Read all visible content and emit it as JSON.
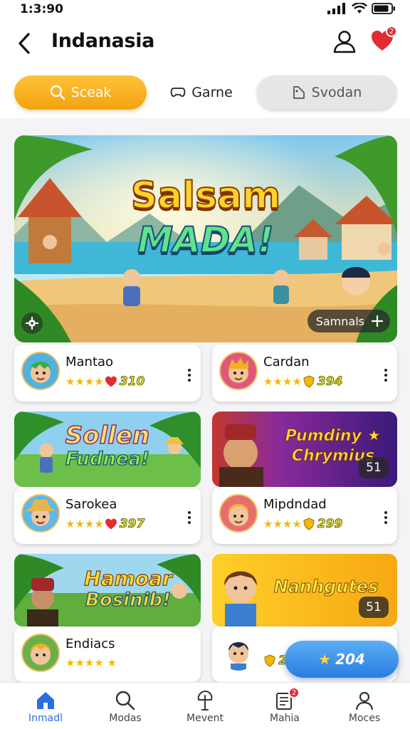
{
  "status": {
    "time": "1:3:90"
  },
  "header": {
    "title": "Indanasia",
    "notif_count": "2"
  },
  "tabs": [
    {
      "label": "Sceak",
      "icon": "search-icon"
    },
    {
      "label": "Garne",
      "icon": "game-icon"
    },
    {
      "label": "Svodan",
      "icon": "tag-icon"
    }
  ],
  "hero": {
    "title_line1": "Salsam",
    "title_line2": "MADA!",
    "chip_label": "Samnals",
    "chip_icon": "plus-icon"
  },
  "cards": [
    {
      "name": "Mantao",
      "score": "310",
      "rating_icon": "heart-icon",
      "stars": 4
    },
    {
      "name": "Cardan",
      "score": "394",
      "rating_icon": "shield-icon",
      "stars": 4
    },
    {
      "name": "Sarokea",
      "score": "397",
      "rating_icon": "heart-icon",
      "stars": 4
    },
    {
      "name": "Mipdndad",
      "score": "299",
      "rating_icon": "shield-icon",
      "stars": 4
    },
    {
      "name": "Endiacs",
      "score": "",
      "rating_icon": "star-icon",
      "stars": 4
    },
    {
      "name": "",
      "score": "2",
      "rating_icon": "shield-icon",
      "stars": 0
    }
  ],
  "banners": [
    {
      "line1": "Sollen",
      "line2": "Fudnea!"
    },
    {
      "line1": "Pumdiny ★",
      "line2": "Chrymius",
      "count": "51"
    },
    {
      "line1": "Hamoar",
      "line2": "Bosinib!"
    },
    {
      "line1": "Nanhgutes",
      "line2": "",
      "count": "51"
    }
  ],
  "fab": {
    "label": "204",
    "icon": "star-icon"
  },
  "nav": [
    {
      "label": "Inmadl",
      "icon": "home-icon",
      "active": true
    },
    {
      "label": "Modas",
      "icon": "search-icon"
    },
    {
      "label": "Mevent",
      "icon": "tree-icon"
    },
    {
      "label": "Mahia",
      "icon": "notes-icon",
      "badge": "2"
    },
    {
      "label": "Moces",
      "icon": "profile-icon"
    }
  ],
  "colors": {
    "accent": "#f4a20f",
    "nav_active": "#2a6fe0",
    "badge": "#e32b32",
    "fab": "#2a7de0"
  }
}
